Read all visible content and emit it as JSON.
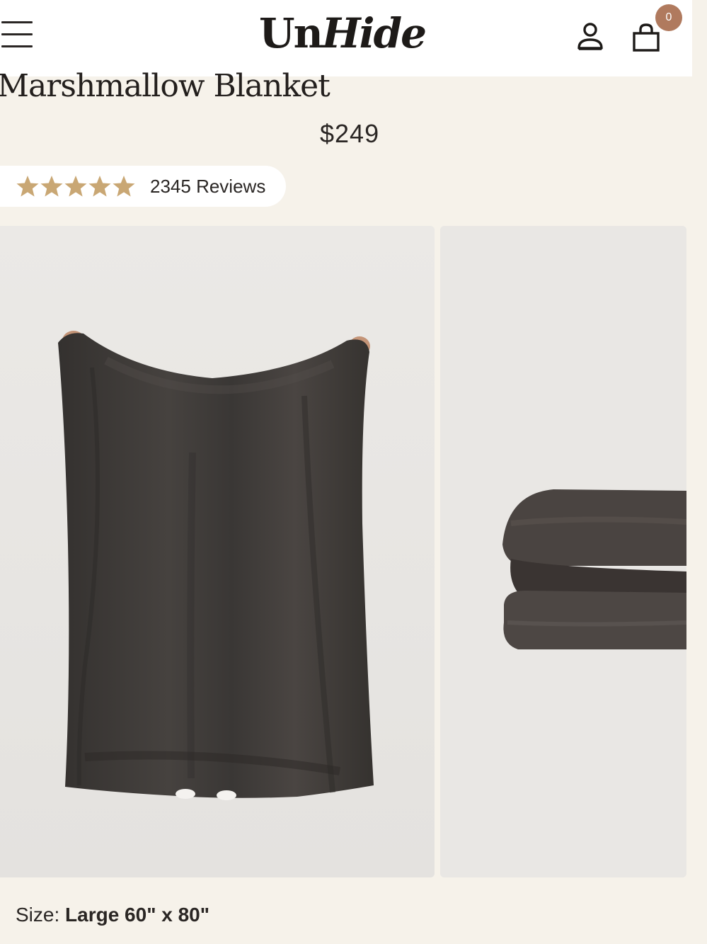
{
  "header": {
    "logo_prefix": "Un",
    "logo_suffix": "Hide",
    "cart_count": "0",
    "icons": {
      "menu": "hamburger-menu-icon",
      "account": "person-icon",
      "cart": "shopping-bag-icon"
    }
  },
  "product": {
    "title": "Marshmallow Blanket",
    "price": "$249",
    "rating": 5,
    "reviews_label": "2345 Reviews",
    "size_label": "Size:",
    "size_value": "Large 60\" x 80\""
  },
  "colors": {
    "background": "#f6f2ea",
    "star": "#c9a774",
    "cart_badge": "#b07a5e",
    "blanket": "#3f3c3a"
  }
}
